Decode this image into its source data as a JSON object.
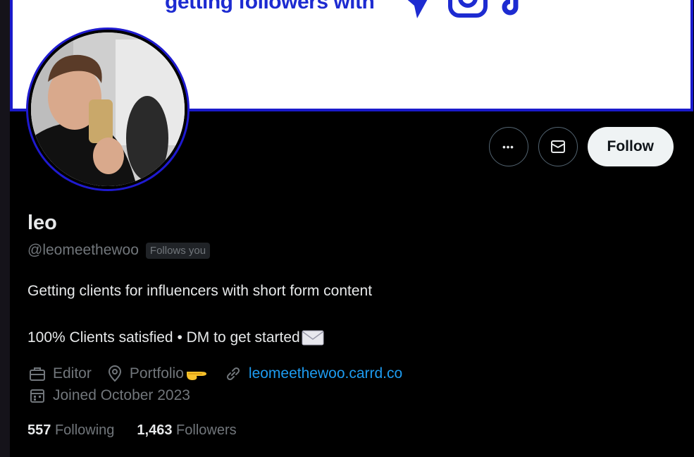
{
  "banner": {
    "text": "getting followers with",
    "icons": [
      "paper-plane-icon",
      "instagram-icon",
      "tiktok-icon"
    ],
    "accent": "#1d2bd1"
  },
  "profile": {
    "display_name": "leo",
    "handle": "@leomeethewoo",
    "follows_you_badge": "Follows you",
    "bio_line1": "Getting clients for influencers with short form content",
    "bio_line2": "100% Clients satisfied • DM to get started",
    "category": "Editor",
    "location": "Portfolio",
    "website": "leomeethewoo.carrd.co",
    "joined": "Joined October 2023",
    "following_count": "557",
    "following_label": "Following",
    "followers_count": "1,463",
    "followers_label": "Followers"
  },
  "actions": {
    "more_label": "•••",
    "follow_label": "Follow"
  },
  "colors": {
    "link": "#1d9bf0",
    "muted": "#71767b",
    "text": "#e7e9ea",
    "avatar_ring": "#1f1ad0"
  }
}
